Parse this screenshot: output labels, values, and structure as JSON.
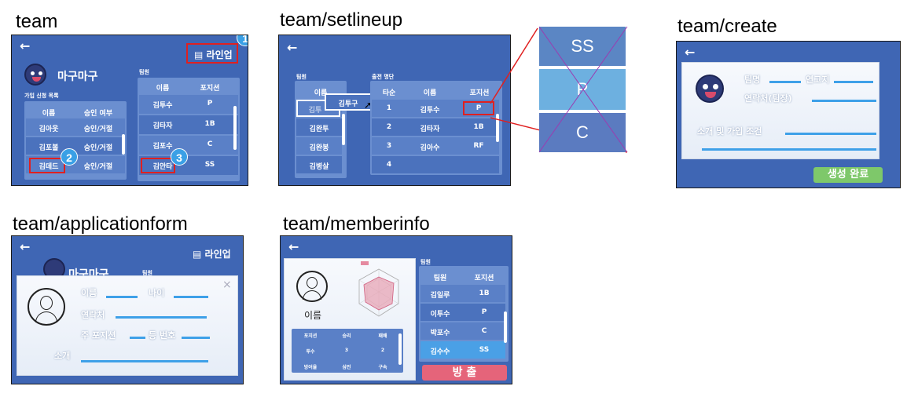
{
  "titles": {
    "team": "team",
    "setlineup": "team/setlineup",
    "create": "team/create",
    "applicationform": "team/applicationform",
    "memberinfo": "team/memberinfo"
  },
  "common": {
    "back_icon": "←"
  },
  "team": {
    "logo_text": "마구마구",
    "lineup_button": "라인업",
    "applications_title": "가입 신청 목록",
    "app_headers": [
      "이름",
      "승인 여부"
    ],
    "applications": [
      {
        "name": "김아웃",
        "action": "승인/거절"
      },
      {
        "name": "김포볼",
        "action": "승인/거절"
      },
      {
        "name": "김데드",
        "action": "승인/거절"
      }
    ],
    "members_title": "팀원",
    "member_headers": [
      "이름",
      "포지션"
    ],
    "members": [
      {
        "name": "김투수",
        "pos": "P"
      },
      {
        "name": "김타자",
        "pos": "1B"
      },
      {
        "name": "김포수",
        "pos": "C"
      },
      {
        "name": "김안타",
        "pos": "SS"
      }
    ],
    "badges": [
      "1",
      "2",
      "3"
    ]
  },
  "setlineup": {
    "members_title": "팀원",
    "members_header": "이름",
    "members": [
      "김투",
      "김완투",
      "김완봉",
      "김병살"
    ],
    "drag_label": "김투구",
    "order_title": "출전 명단",
    "order_headers": [
      "타순",
      "이름",
      "포지션"
    ],
    "order": [
      {
        "no": "1",
        "name": "김투수",
        "pos": "P"
      },
      {
        "no": "2",
        "name": "김타자",
        "pos": "1B"
      },
      {
        "no": "3",
        "name": "김아수",
        "pos": "RF"
      },
      {
        "no": "4",
        "name": "",
        "pos": ""
      }
    ],
    "pos_options": [
      "SS",
      "P",
      "C"
    ]
  },
  "create": {
    "team_name": "팀명",
    "region": "연고지",
    "contact": "연락처(팀장)",
    "intro": "소개 및 가입 조건",
    "complete_button": "생성 완료"
  },
  "applicationform": {
    "logo_text": "마구마구",
    "members_title": "팀원",
    "lineup_button": "라인업",
    "close": "×",
    "name": "이름",
    "age": "나이",
    "contact": "연락처",
    "main_pos": "주 포지션",
    "number": "등 번호",
    "intro": "소개"
  },
  "memberinfo": {
    "name": "이름",
    "members_title": "팀원",
    "member_headers": [
      "팀원",
      "포지션"
    ],
    "members": [
      {
        "name": "김일루",
        "pos": "1B"
      },
      {
        "name": "이투수",
        "pos": "P"
      },
      {
        "name": "박포수",
        "pos": "C"
      },
      {
        "name": "김수수",
        "pos": "SS"
      }
    ],
    "stats_headers": [
      "포지션",
      "승리",
      "패배"
    ],
    "stats_values": [
      "투수",
      "3",
      "2"
    ],
    "stats_extra": [
      "방어율",
      "삼진",
      "구속"
    ],
    "kick_button": "방 출"
  }
}
